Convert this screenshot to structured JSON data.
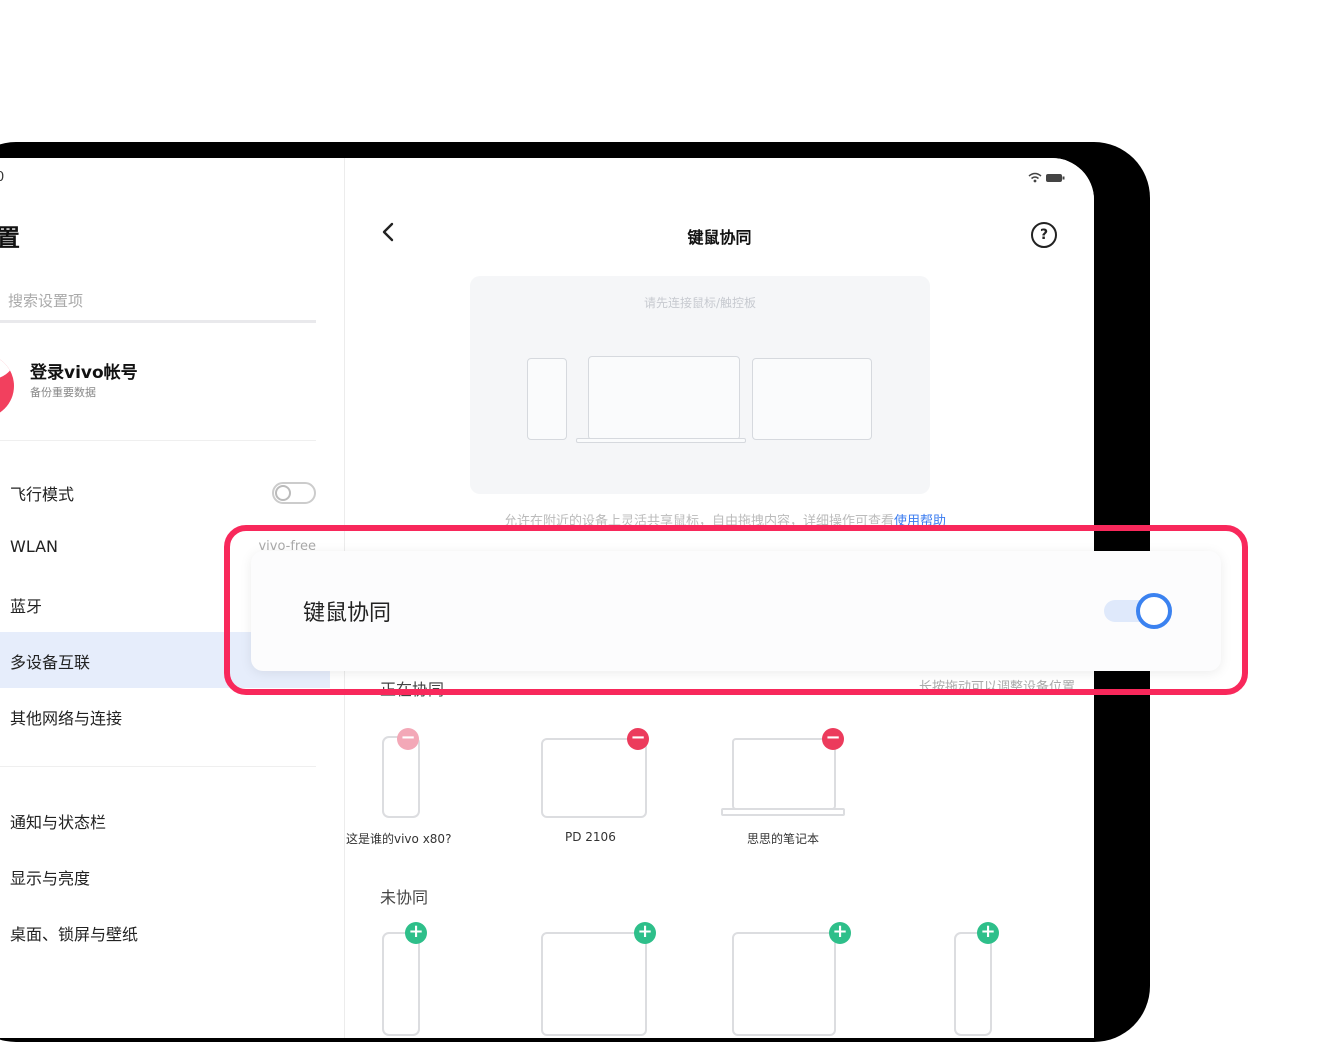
{
  "status": {
    "time": "0",
    "icons": "wifi battery"
  },
  "sidebar": {
    "title": "置",
    "search_placeholder": "搜索设置项",
    "account": {
      "name": "登录vivo帐号",
      "subtitle": "备份重要数据"
    },
    "items": [
      {
        "label": "飞行模式",
        "toggle": "off"
      },
      {
        "label": "WLAN",
        "value": "vivo-free"
      },
      {
        "label": "蓝牙"
      },
      {
        "label": "多设备互联",
        "active": true
      },
      {
        "label": "其他网络与连接"
      },
      {
        "label": "通知与状态栏"
      },
      {
        "label": "显示与亮度"
      },
      {
        "label": "桌面、锁屏与壁纸"
      }
    ]
  },
  "main": {
    "title": "键鼠协同",
    "illustration_hint": "请先连接鼠标/触控板",
    "description": "允许在附近的设备上灵活共享鼠标，自由拖拽内容，详细操作可查看",
    "description_link": "使用帮助",
    "section_active": "正在协同",
    "section_active_hint": "长按拖动可以调整设备位置",
    "active_devices": [
      {
        "name": "这是谁的vivo x80?",
        "type": "phone"
      },
      {
        "name": "PD 2106",
        "type": "tablet"
      },
      {
        "name": "思思的笔记本",
        "type": "laptop"
      }
    ],
    "section_inactive": "未协同",
    "inactive_devices": [
      {
        "type": "phone"
      },
      {
        "type": "tablet"
      },
      {
        "type": "laptop"
      },
      {
        "type": "phone"
      }
    ]
  },
  "overlay": {
    "label": "键鼠协同",
    "toggle": "on",
    "colors": {
      "highlight": "#f8285b",
      "accent": "#3b82f0"
    }
  }
}
